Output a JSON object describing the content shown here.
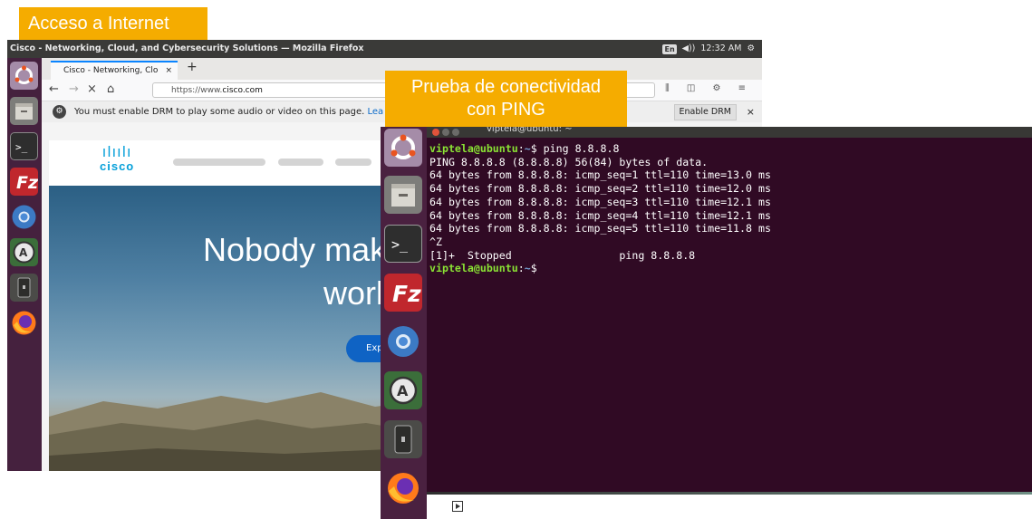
{
  "callouts": {
    "internet": "Acceso a Internet",
    "ping_line1": "Prueba de conectividad",
    "ping_line2": "con PING"
  },
  "browser": {
    "window_title": "Cisco - Networking, Cloud, and Cybersecurity Solutions — Mozilla Firefox",
    "tray": {
      "keyboard": "En",
      "volume": "◀))",
      "time": "12:32 AM",
      "power": "⚙"
    },
    "tab_label": "Cisco - Networking, Clo",
    "tab_close": "×",
    "new_tab": "+",
    "nav": {
      "back": "←",
      "forward": "→",
      "stop": "×",
      "home": "⌂"
    },
    "url_prefix": "https://www.",
    "url_domain": "cisco.com",
    "toolbar_icons": "⫼ ◫ ⚙ ≡",
    "drm_message": "You must enable DRM to play some audio or video on this page.",
    "drm_learn": "Lea",
    "drm_button": "Enable DRM",
    "drm_close": "×",
    "cisco_logo_bars": "ılıılı",
    "cisco_logo_word": "cisco",
    "hero_line1": "Nobody mak",
    "hero_line2": "work",
    "hero_button": "Explo",
    "launcher_icons": [
      "ubuntu-logo",
      "file-cabinet",
      "terminal",
      "filezilla",
      "chromium",
      "software-updater",
      "usb-drive",
      "firefox"
    ]
  },
  "terminal": {
    "title": "viptela@ubuntu: ~",
    "user_host": "viptela@ubuntu",
    "path": "~",
    "command": "ping 8.8.8.8",
    "lines": [
      "PING 8.8.8.8 (8.8.8.8) 56(84) bytes of data.",
      "64 bytes from 8.8.8.8: icmp_seq=1 ttl=110 time=13.0 ms",
      "64 bytes from 8.8.8.8: icmp_seq=2 ttl=110 time=12.0 ms",
      "64 bytes from 8.8.8.8: icmp_seq=3 ttl=110 time=12.1 ms",
      "64 bytes from 8.8.8.8: icmp_seq=4 ttl=110 time=12.1 ms",
      "64 bytes from 8.8.8.8: icmp_seq=5 ttl=110 time=11.8 ms",
      "^Z",
      "[1]+  Stopped                 ping 8.8.8.8"
    ],
    "launcher_icons": [
      "ubuntu-logo",
      "file-cabinet",
      "terminal",
      "filezilla",
      "chromium",
      "software-updater",
      "usb-drive",
      "firefox"
    ]
  },
  "colors": {
    "callout": "#f5ac00",
    "launcher": "#45213e",
    "terminal_bg": "#300a24",
    "prompt_green": "#8ae234",
    "path_blue": "#729fcf",
    "cisco_blue": "#049fd9"
  }
}
